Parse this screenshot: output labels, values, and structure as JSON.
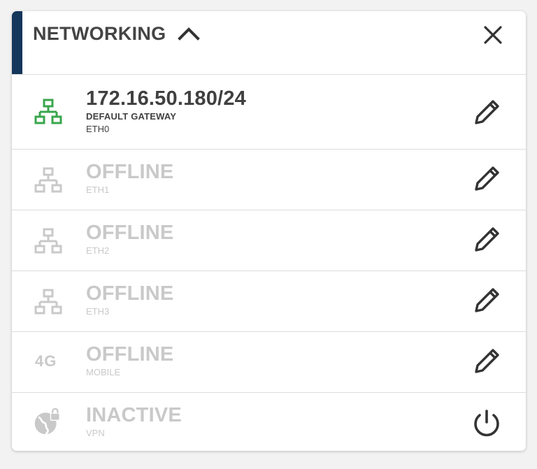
{
  "panel": {
    "title": "NETWORKING",
    "collapse_icon": "chevron-up-icon",
    "close_icon": "close-icon",
    "accent_color": "#14365a"
  },
  "interfaces": [
    {
      "primary": "172.16.50.180/24",
      "secondary": "DEFAULT GATEWAY",
      "name": "ETH0",
      "status": "online",
      "icon": "network-icon",
      "action_icon": "edit-icon"
    },
    {
      "primary": "OFFLINE",
      "name": "ETH1",
      "status": "offline",
      "icon": "network-icon",
      "action_icon": "edit-icon"
    },
    {
      "primary": "OFFLINE",
      "name": "ETH2",
      "status": "offline",
      "icon": "network-icon",
      "action_icon": "edit-icon"
    },
    {
      "primary": "OFFLINE",
      "name": "ETH3",
      "status": "offline",
      "icon": "network-icon",
      "action_icon": "edit-icon"
    },
    {
      "primary": "OFFLINE",
      "name": "MOBILE",
      "status": "offline",
      "icon": "4g-icon",
      "icon_text": "4G",
      "action_icon": "edit-icon"
    },
    {
      "primary": "INACTIVE",
      "name": "VPN",
      "status": "inactive",
      "icon": "globe-lock-icon",
      "action_icon": "power-icon"
    }
  ],
  "colors": {
    "online": "#3aa64c",
    "offline": "#c9c9c9",
    "text_dark": "#404040"
  }
}
